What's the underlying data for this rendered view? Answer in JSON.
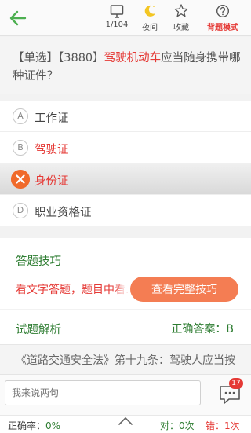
{
  "topbar": {
    "progress": "1/104",
    "night_label": "夜间",
    "favorite_label": "收藏",
    "mode_label": "背题模式"
  },
  "question": {
    "type_tag": "【单选】",
    "id_tag": "【3880】",
    "keyword": "驾驶机动车",
    "rest": "应当随身携带哪种证件？"
  },
  "options": [
    {
      "letter": "A",
      "text": "工作证",
      "state": "normal"
    },
    {
      "letter": "B",
      "text": "驾驶证",
      "state": "correct"
    },
    {
      "letter": "C",
      "text": "身份证",
      "state": "wrong"
    },
    {
      "letter": "D",
      "text": "职业资格证",
      "state": "normal"
    }
  ],
  "tips": {
    "title": "答题技巧",
    "text": "看文字答题，题目中看...",
    "button": "查看完整技巧"
  },
  "analysis": {
    "title": "试题解析",
    "answer": "正确答案：B",
    "content": "《道路交通安全法》第十九条：驾驶人应当按"
  },
  "comment": {
    "placeholder": "我来说两句",
    "badge": "17"
  },
  "stats": {
    "rate_label": "正确率：",
    "rate_value": "0%",
    "correct": "对：0次",
    "wrong": "错：1次"
  },
  "colors": {
    "accent_green": "#2e7d32",
    "accent_red": "#e53935",
    "accent_orange": "#f47d53"
  }
}
